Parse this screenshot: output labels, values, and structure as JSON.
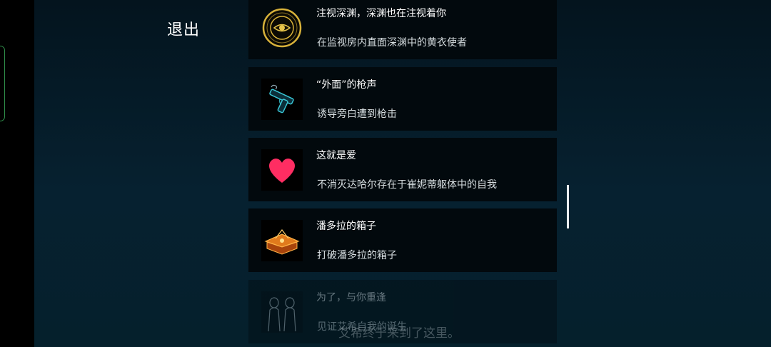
{
  "exit_label": "退出",
  "achievements": [
    {
      "title": "注视深渊，深渊也在注视着你",
      "desc": "在监视房内直面深渊中的黄衣使者",
      "icon": "eye-emblem-icon"
    },
    {
      "title": "“外面”的枪声",
      "desc": "诱导旁白遭到枪击",
      "icon": "pistol-icon"
    },
    {
      "title": "这就是爱",
      "desc": "不消灭达哈尔存在于崔妮蒂躯体中的自我",
      "icon": "heart-icon"
    },
    {
      "title": "潘多拉的箱子",
      "desc": "打破潘多拉的箱子",
      "icon": "pandora-box-icon"
    },
    {
      "title": "为了，与你重逢",
      "desc": "见证艾希自我的诞生",
      "icon": "twin-figures-icon"
    }
  ],
  "bottom_text": "艾希终于来到了这里。",
  "colors": {
    "background": "#04131c",
    "card": "#02090d",
    "heart": "#ff2d62",
    "gold": "#d8b23a",
    "cyan": "#39c6d6"
  }
}
